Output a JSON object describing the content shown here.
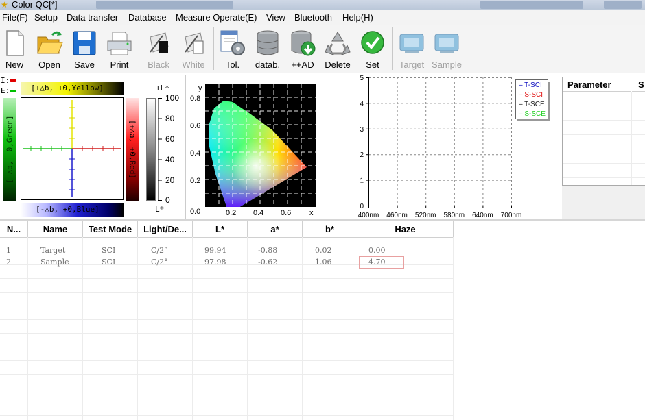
{
  "window": {
    "title": "Color QC[*]"
  },
  "menu": [
    "File(F)",
    "Setup",
    "Data transfer",
    "Database",
    "Measure Operate(E)",
    "View",
    "Bluetooth",
    "Help(H)"
  ],
  "toolbar": {
    "new": "New",
    "open": "Open",
    "save": "Save",
    "print": "Print",
    "black": "Black",
    "white": "White",
    "tol": "Tol.",
    "datab": "datab.",
    "add": "++AD",
    "delete": "Delete",
    "set": "Set",
    "target": "Target",
    "sample": "Sample"
  },
  "ab_panel": {
    "i_label": "I:",
    "e_label": "E:",
    "yellow_label": "[+△b, +0,Yellow]",
    "blue_label": "[-△b, +0,Blue]",
    "green_label": "[-△a, -0,Green]",
    "red_label": "[+△a, +0,Red]",
    "plus_l": "+L*",
    "minus_l": "L*",
    "l_ticks": [
      "100",
      "80",
      "60",
      "40",
      "20",
      "0"
    ]
  },
  "cie": {
    "y_label": "y",
    "x_label": "x",
    "y_ticks": [
      "0.8",
      "0.6",
      "0.4",
      "0.2",
      "0.0"
    ],
    "x_ticks": [
      "0.2",
      "0.4",
      "0.6"
    ]
  },
  "chart_data": {
    "type": "line",
    "title": "",
    "x": [
      "400nm",
      "460nm",
      "520nm",
      "580nm",
      "640nm",
      "700nm"
    ],
    "y_ticks": [
      "0",
      "1",
      "2",
      "3",
      "4",
      "5"
    ],
    "ylim": [
      0,
      5
    ],
    "grid": true,
    "legend_position": "top-right",
    "series": [
      {
        "name": "T-SCI",
        "color": "#1010c0",
        "values": []
      },
      {
        "name": "S-SCI",
        "color": "#e01010",
        "values": []
      },
      {
        "name": "T-SCE",
        "color": "#202020",
        "values": []
      },
      {
        "name": "S-SCE",
        "color": "#20d020",
        "values": []
      }
    ]
  },
  "param": {
    "col1": "Parameter",
    "col2": "S"
  },
  "table": {
    "headers": [
      "N...",
      "Name",
      "Test Mode",
      "Light/De...",
      "L*",
      "a*",
      "b*",
      "Haze"
    ],
    "rows": [
      [
        "1",
        "Target",
        "SCI",
        "C/2°",
        "99.94",
        "-0.88",
        "0.02",
        "0.00"
      ],
      [
        "2",
        "Sample",
        "SCI",
        "C/2°",
        "97.98",
        "-0.62",
        "1.06",
        "4.70"
      ]
    ]
  },
  "colors": {
    "i_indicator": "#e00000",
    "e_indicator": "#00c000",
    "selected_cell_border": "#e8a0a0"
  }
}
